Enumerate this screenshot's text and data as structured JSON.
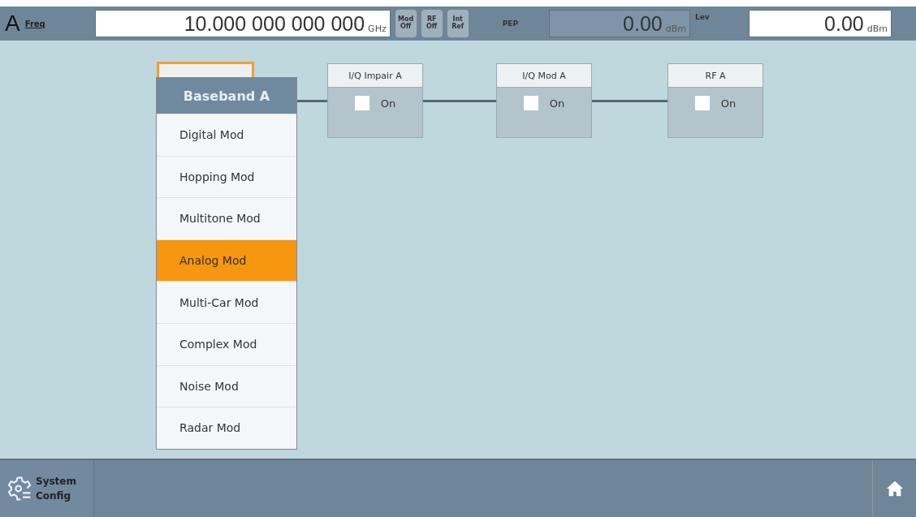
{
  "top_bar": {
    "channel": "A",
    "freq_label": "Freq",
    "freq_value": "10.000 000 000 000",
    "freq_unit": "GHz",
    "toggles": [
      {
        "top": "Mod",
        "bottom": "Off"
      },
      {
        "top": "RF",
        "bottom": "Off"
      },
      {
        "top": "Int",
        "bottom": "Ref"
      }
    ],
    "pep_label": "PEP",
    "pep_value": "0.00",
    "pep_unit": "dBm",
    "lev_label": "Lev",
    "lev_value": "0.00",
    "lev_unit": "dBm"
  },
  "blocks": [
    {
      "kind": "hidden"
    },
    {
      "kind": "block",
      "label": "I/Q Impair A",
      "checkbox_label": "On",
      "checked": false
    },
    {
      "kind": "block",
      "label": "I/Q Mod A",
      "checkbox_label": "On",
      "checked": false
    },
    {
      "kind": "block",
      "label": "RF A",
      "checkbox_label": "On",
      "checked": false
    }
  ],
  "menu": {
    "title": "Baseband A",
    "items": [
      {
        "label": "Digital Mod",
        "selected": false
      },
      {
        "label": "Hopping Mod",
        "selected": false
      },
      {
        "label": "Multitone Mod",
        "selected": false
      },
      {
        "label": "Analog Mod",
        "selected": true
      },
      {
        "label": "Multi-Car Mod",
        "selected": false
      },
      {
        "label": "Complex Mod",
        "selected": false
      },
      {
        "label": "Noise Mod",
        "selected": false
      },
      {
        "label": "Radar Mod",
        "selected": false
      }
    ]
  },
  "bottom_bar": {
    "system_config": [
      "System",
      "Config"
    ]
  }
}
